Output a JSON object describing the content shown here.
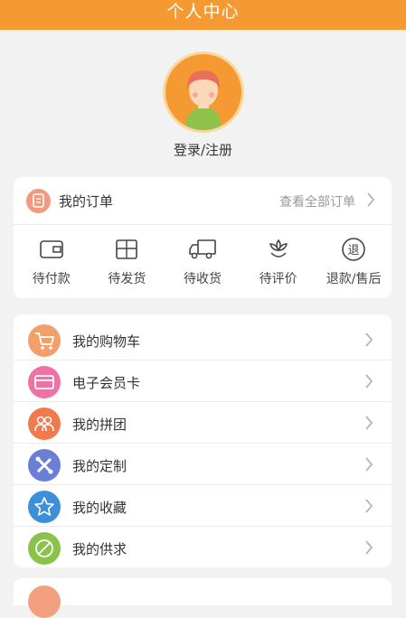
{
  "header": {
    "title": "个人中心"
  },
  "profile": {
    "login_label": "登录/注册"
  },
  "orders": {
    "title": "我的订单",
    "view_all": "查看全部订单",
    "statuses": [
      {
        "label": "待付款",
        "icon": "wallet-icon"
      },
      {
        "label": "待发货",
        "icon": "package-icon"
      },
      {
        "label": "待收货",
        "icon": "truck-icon"
      },
      {
        "label": "待评价",
        "icon": "flower-icon"
      },
      {
        "label": "退款/售后",
        "icon": "refund-icon",
        "icon_text": "退"
      }
    ]
  },
  "menu": [
    {
      "label": "我的购物车",
      "icon": "cart-icon",
      "color": "#f2a06a"
    },
    {
      "label": "电子会员卡",
      "icon": "card-icon",
      "color": "#ee72a5"
    },
    {
      "label": "我的拼团",
      "icon": "group-icon",
      "color": "#f07a4e"
    },
    {
      "label": "我的定制",
      "icon": "tools-icon",
      "color": "#6b7fd8"
    },
    {
      "label": "我的收藏",
      "icon": "star-icon",
      "color": "#3d8fd8"
    },
    {
      "label": "我的供求",
      "icon": "supply-icon",
      "color": "#8bc34a"
    }
  ],
  "colors": {
    "header_bg": "#f59a33",
    "page_bg": "#f2f2f2",
    "order_icon": "#f29a7e"
  }
}
